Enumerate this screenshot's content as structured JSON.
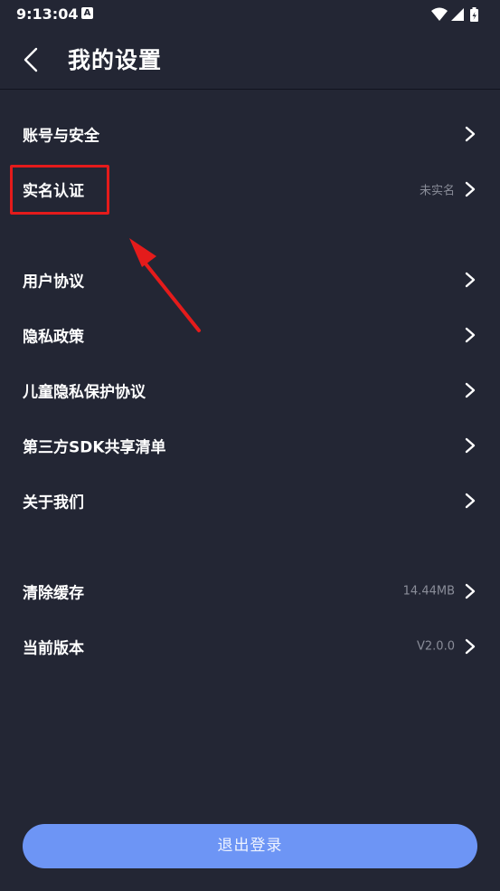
{
  "status_bar": {
    "time": "9:13:04",
    "notification_badge": "A"
  },
  "header": {
    "title": "我的设置",
    "back_icon": "chevron-left-icon"
  },
  "settings": {
    "account_security": {
      "label": "账号与安全",
      "value": ""
    },
    "real_name": {
      "label": "实名认证",
      "value": "未实名"
    },
    "user_agreement": {
      "label": "用户协议",
      "value": ""
    },
    "privacy_policy": {
      "label": "隐私政策",
      "value": ""
    },
    "child_privacy": {
      "label": "儿童隐私保护协议",
      "value": ""
    },
    "third_party_sdk": {
      "label": "第三方SDK共享清单",
      "value": ""
    },
    "about_us": {
      "label": "关于我们",
      "value": ""
    },
    "clear_cache": {
      "label": "清除缓存",
      "value": "14.44MB"
    },
    "current_version": {
      "label": "当前版本",
      "value": "V2.0.0"
    }
  },
  "logout": {
    "label": "退出登录"
  },
  "colors": {
    "background": "#232634",
    "accent_button": "#6d95f5",
    "annotation_red": "#e41b1b",
    "secondary_text": "#8a8d99"
  }
}
